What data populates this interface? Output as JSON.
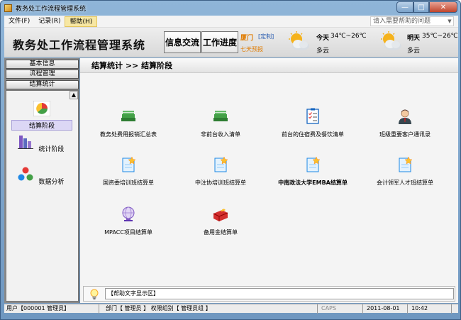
{
  "window": {
    "title": "教务处工作流程管理系统",
    "min": "—",
    "max": "□",
    "close": "✕"
  },
  "menu": {
    "items": [
      {
        "label": "文件(F)"
      },
      {
        "label": "记录(R)"
      },
      {
        "label": "帮助(H)"
      }
    ],
    "help_search_placeholder": "请入需要帮助的问题"
  },
  "header": {
    "title": "教务处工作流程管理系统",
    "buttons": [
      "信息交流",
      "工作进度"
    ],
    "city": "厦门",
    "custom": "[定制]",
    "forecast": "七天预报",
    "weather": [
      {
        "day": "今天",
        "temp": "34℃~26℃",
        "desc": "多云",
        "icon": "partly-cloudy-icon"
      },
      {
        "day": "明天",
        "temp": "35℃~26℃",
        "desc": "多云",
        "icon": "partly-cloudy-icon"
      }
    ]
  },
  "sidebar": {
    "tabs": [
      "基本信息",
      "流程管理",
      "结算统计"
    ],
    "items": [
      {
        "label": "结算阶段",
        "icon": "chart-pie-icon",
        "selected": true
      },
      {
        "label": "统计阶段",
        "icon": "bar-chart-icon",
        "selected": false
      },
      {
        "label": "数据分析",
        "icon": "molecule-icon",
        "selected": false
      }
    ]
  },
  "main": {
    "breadcrumb": "结算统计  >>  结算阶段",
    "items": [
      {
        "label": "教务处费用报销汇总表",
        "icon": "books-icon"
      },
      {
        "label": "非前台收入清单",
        "icon": "books-icon"
      },
      {
        "label": "前台的住宿费及餐饮清单",
        "icon": "checklist-icon"
      },
      {
        "label": "班级重要客户通讯录",
        "icon": "person-icon"
      },
      {
        "label": "国资委培训班结算单",
        "icon": "document-star-icon"
      },
      {
        "label": "中注协培训班结算单",
        "icon": "document-star-icon"
      },
      {
        "label": "中南政法大学EMBA结算单",
        "icon": "document-star-icon",
        "bold": true
      },
      {
        "label": "会计领军人才班结算单",
        "icon": "document-star-icon"
      },
      {
        "label": "MPACC项目结算单",
        "icon": "globe-icon"
      },
      {
        "label": "备用金结算单",
        "icon": "gift-icon"
      }
    ]
  },
  "helpbar": {
    "text": "【帮助文字显示区】"
  },
  "status": {
    "user": "用户【000001 管理员】",
    "dept": "部门【 管理员 】 权限组别【 管理员组 】",
    "caps": "CAPS",
    "date": "2011-08-01",
    "time": "10:42"
  },
  "colors": {
    "accent_orange": "#e07b00",
    "link_blue": "#2a5db0",
    "sidebar_gray": "#8a8a8a"
  }
}
